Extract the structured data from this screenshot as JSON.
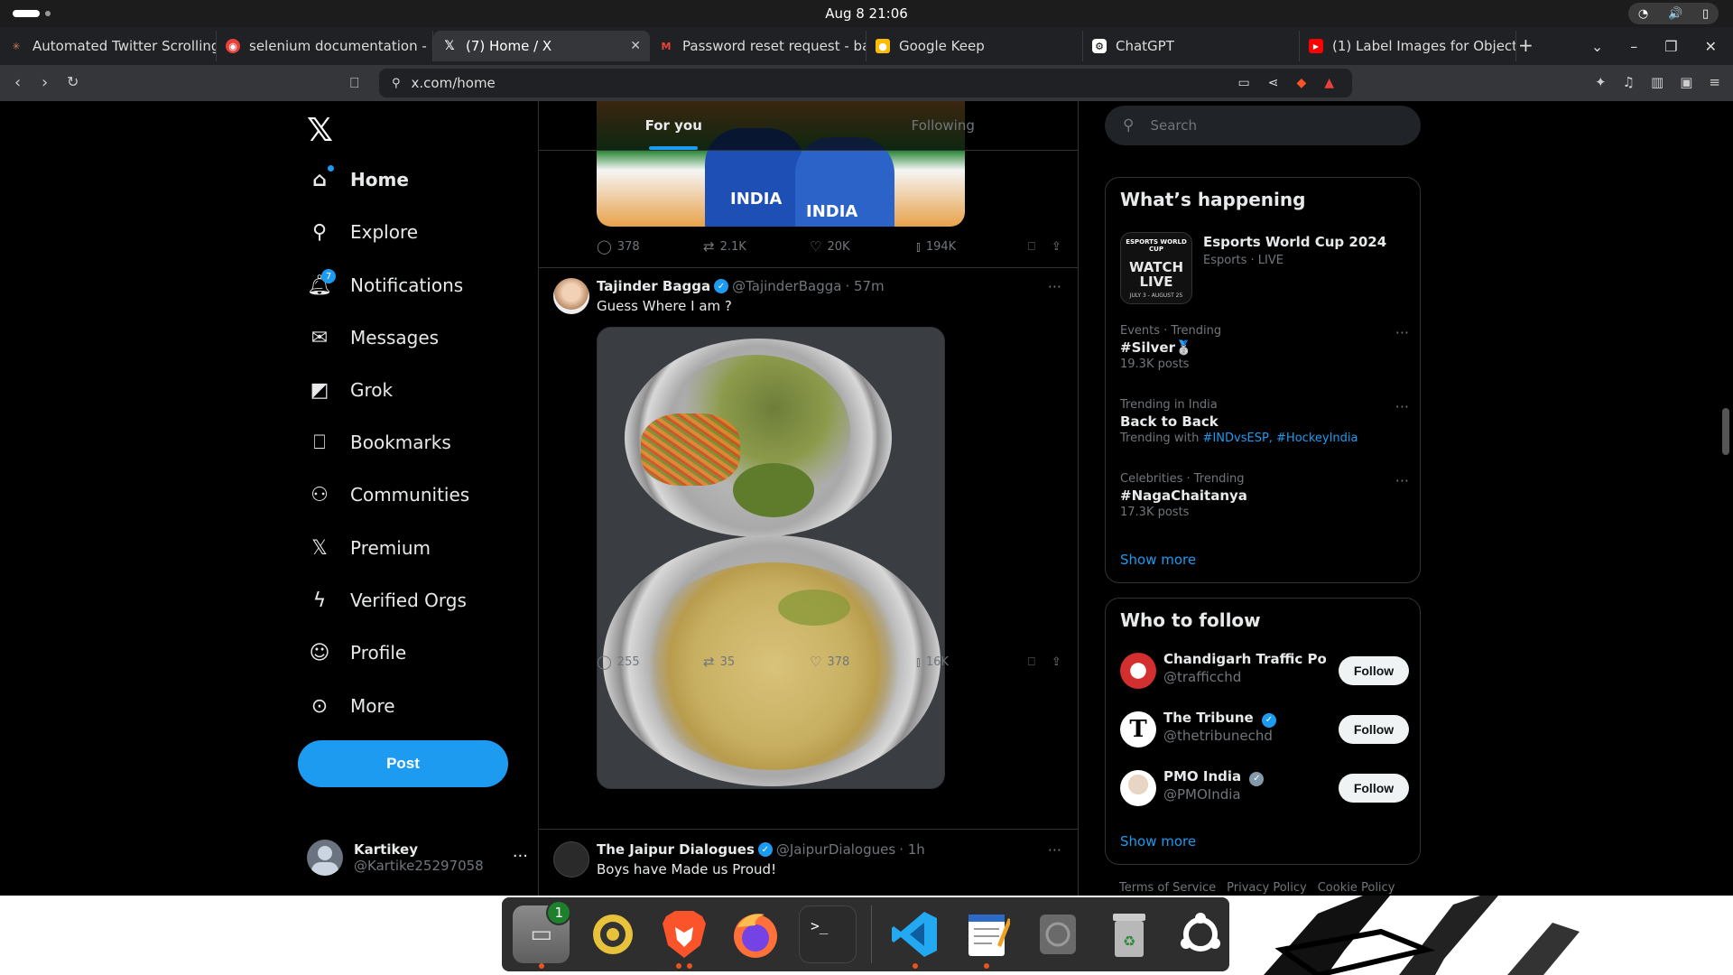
{
  "system": {
    "clock": "Aug 8  21:06"
  },
  "browser": {
    "tabs": [
      {
        "title": "Automated Twitter Scrolling",
        "icon": "claude-icon",
        "color": "#d97757"
      },
      {
        "title": "selenium documentation - B",
        "icon": "brave-search-icon",
        "color": "#e8403a"
      },
      {
        "title": "(7) Home / X",
        "icon": "x-icon",
        "color": "#ffffff",
        "active": true
      },
      {
        "title": "Password reset request - bai",
        "icon": "gmail-icon",
        "color": "#ea4335"
      },
      {
        "title": "Google Keep",
        "icon": "keep-icon",
        "color": "#fbbc04"
      },
      {
        "title": "ChatGPT",
        "icon": "chatgpt-icon",
        "color": "#ffffff"
      },
      {
        "title": "(1) Label Images for Object",
        "icon": "youtube-icon",
        "color": "#ff0000"
      }
    ],
    "url": "x.com/home"
  },
  "leftnav": {
    "items": [
      {
        "label": "Home",
        "icon": "home-icon"
      },
      {
        "label": "Explore",
        "icon": "search-icon"
      },
      {
        "label": "Notifications",
        "icon": "bell-icon",
        "badge": "7"
      },
      {
        "label": "Messages",
        "icon": "envelope-icon"
      },
      {
        "label": "Grok",
        "icon": "grok-icon"
      },
      {
        "label": "Bookmarks",
        "icon": "bookmark-icon"
      },
      {
        "label": "Communities",
        "icon": "people-icon"
      },
      {
        "label": "Premium",
        "icon": "x-icon"
      },
      {
        "label": "Verified Orgs",
        "icon": "lightning-icon"
      },
      {
        "label": "Profile",
        "icon": "person-icon"
      },
      {
        "label": "More",
        "icon": "more-circle-icon"
      }
    ],
    "post_label": "Post",
    "account": {
      "name": "Kartikey",
      "handle": "@Kartike25297058"
    }
  },
  "feed": {
    "tabs": [
      "For you",
      "Following"
    ],
    "top_image_text": [
      "INDIA",
      "INDIA"
    ],
    "tweet0_stats": {
      "replies": "378",
      "reposts": "2.1K",
      "likes": "20K",
      "views": "194K"
    },
    "tweet1": {
      "name": "Tajinder Bagga",
      "handle": "@TajinderBagga",
      "time": "· 57m",
      "text": "Guess Where I am ?",
      "stats": {
        "replies": "255",
        "reposts": "35",
        "likes": "378",
        "views": "16K"
      }
    },
    "tweet2": {
      "name": "The Jaipur Dialogues",
      "handle": "@JaipurDialogues",
      "time": "· 1h",
      "text": "Boys have Made us Proud!"
    }
  },
  "right": {
    "search_placeholder": "Search",
    "happening_title": "What’s happening",
    "event": {
      "title": "Esports World Cup 2024",
      "meta": "Esports · LIVE",
      "thumb_text": "WATCH LIVE",
      "thumb_top": "ESPORTS WORLD CUP",
      "thumb_dates": "JULY 3 - AUGUST 25"
    },
    "trends": [
      {
        "meta": "Events · Trending",
        "title": "#Silver🥈",
        "count": "19.3K posts"
      },
      {
        "meta": "Trending in India",
        "title": "Back to Back",
        "count_prefix": "Trending with",
        "links": "#INDvsESP, #HockeyIndia"
      },
      {
        "meta": "Celebrities · Trending",
        "title": "#NagaChaitanya",
        "count": "17.3K posts"
      }
    ],
    "show_more": "Show more",
    "follow_title": "Who to follow",
    "follow": [
      {
        "name": "Chandigarh Traffic Police",
        "handle": "@trafficchd",
        "btn": "Follow"
      },
      {
        "name": "The Tribune",
        "handle": "@thetribunechd",
        "btn": "Follow"
      },
      {
        "name": "PMO India",
        "handle": "@PMOIndia",
        "btn": "Follow"
      }
    ],
    "footer": [
      "Terms of Service",
      "Privacy Policy",
      "Cookie Policy"
    ]
  },
  "dock": {
    "apps": [
      "files-icon",
      "rhythmbox-icon",
      "brave-icon",
      "firefox-icon",
      "terminal-icon",
      "vscode-icon",
      "text-editor-icon",
      "disk-icon",
      "trash-icon",
      "ubuntu-icon"
    ],
    "files_badge": "1",
    "terminal_glyph": ">_"
  }
}
